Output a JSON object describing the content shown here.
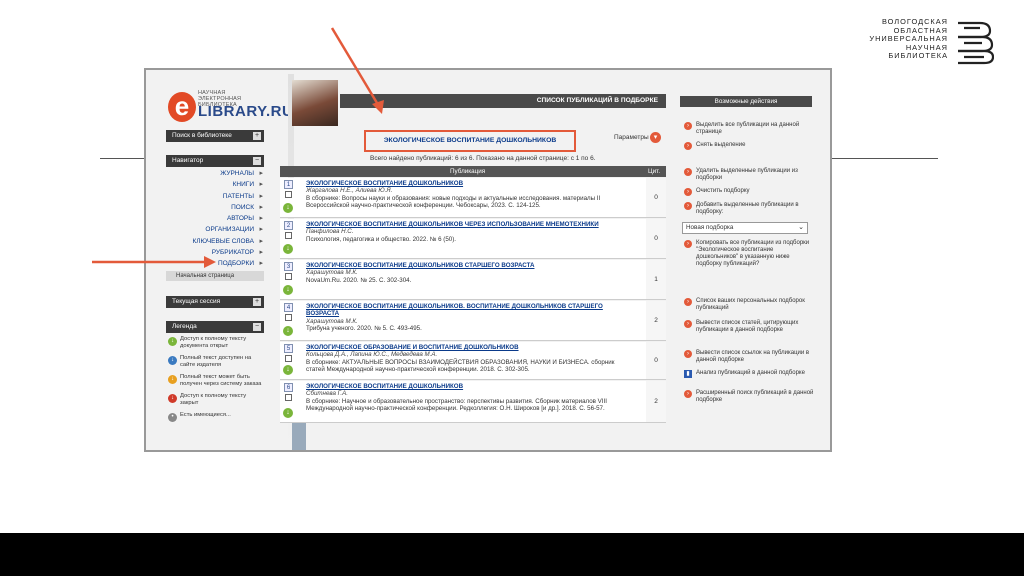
{
  "brand_logo": {
    "lines": [
      "ВОЛОГОДСКАЯ",
      "ОБЛАСТНАЯ",
      "УНИВЕРСАЛЬНАЯ",
      "НАУЧНАЯ",
      "БИБЛИОТЕКА"
    ]
  },
  "elib": {
    "logo_small": "НАУЧНАЯ ЭЛЕКТРОННАЯ БИБЛИОТЕКА",
    "logo_letter": "e",
    "logo_big": "LIBRARY.RU"
  },
  "left": {
    "search_library": "Поиск в библиотеке",
    "navigator": "Навигатор",
    "nav_items": [
      "ЖУРНАЛЫ",
      "КНИГИ",
      "ПАТЕНТЫ",
      "ПОИСК",
      "АВТОРЫ",
      "ОРГАНИЗАЦИИ",
      "КЛЮЧЕВЫЕ СЛОВА",
      "РУБРИКАТОР",
      "ПОДБОРКИ"
    ],
    "nav_sub": "Начальная страница",
    "current_session": "Текущая сессия",
    "legend_header": "Легенда",
    "legend_items": [
      "Доступ к полному тексту документа открыт",
      "Полный текст доступен на сайте издателя",
      "Полный текст может быть получен через систему заказа",
      "Доступ к полному тексту закрыт",
      "Есть имеющиеся..."
    ]
  },
  "center": {
    "header": "СПИСОК ПУБЛИКАЦИЙ В ПОДБОРКЕ",
    "selection_title": "ЭКОЛОГИЧЕСКОЕ ВОСПИТАНИЕ ДОШКОЛЬНИКОВ",
    "params_label": "Параметры",
    "found_text": "Всего найдено публикаций: 6 из 6.    Показано на данной странице: с 1 по 6.",
    "col_publication": "Публикация",
    "col_citations": "Цит.",
    "rows": [
      {
        "num": "1",
        "title": "ЭКОЛОГИЧЕСКОЕ ВОСПИТАНИЕ ДОШКОЛЬНИКОВ",
        "authors": "Жаргалова Н.Е., Алиева Ю.Я.",
        "source": "В сборнике: Вопросы науки и образования: новые подходы и актуальные исследования. материалы II Всероссийской научно-практической конференции. Чебоксары, 2023. С. 124-125.",
        "citations": "0"
      },
      {
        "num": "2",
        "title": "ЭКОЛОГИЧЕСКОЕ ВОСПИТАНИЕ ДОШКОЛЬНИКОВ ЧЕРЕЗ ИСПОЛЬЗОВАНИЕ МНЕМОТЕХНИКИ",
        "authors": "Панфилова Н.С.",
        "source": "Психология, педагогика и общество. 2022. № 6 (50).",
        "citations": "0"
      },
      {
        "num": "3",
        "title": "ЭКОЛОГИЧЕСКОЕ ВОСПИТАНИЕ ДОШКОЛЬНИКОВ СТАРШЕГО ВОЗРАСТА",
        "authors": "Харашутова М.К.",
        "source": "NovaUm.Ru. 2020. № 25. С. 302-304.",
        "citations": "1"
      },
      {
        "num": "4",
        "title": "ЭКОЛОГИЧЕСКОЕ ВОСПИТАНИЕ ДОШКОЛЬНИКОВ. ВОСПИТАНИЕ ДОШКОЛЬНИКОВ СТАРШЕГО ВОЗРАСТА",
        "authors": "Харашутова М.К.",
        "source": "Трибуна ученого. 2020. № 5. С. 493-495.",
        "citations": "2"
      },
      {
        "num": "5",
        "title": "ЭКОЛОГИЧЕСКОЕ ОБРАЗОВАНИЕ И ВОСПИТАНИЕ ДОШКОЛЬНИКОВ",
        "authors": "Кольцова Д.А., Лапина Ю.С., Медведева М.А.",
        "source": "В сборнике: АКТУАЛЬНЫЕ ВОПРОСЫ ВЗАИМОДЕЙСТВИЯ ОБРАЗОВАНИЯ, НАУКИ И БИЗНЕСА. сборник статей Международной научно-практической конференции. 2018. С. 302-305.",
        "citations": "0"
      },
      {
        "num": "6",
        "title": "ЭКОЛОГИЧЕСКОЕ ВОСПИТАНИЕ ДОШКОЛЬНИКОВ",
        "authors": "Сбитнева Г.А.",
        "source": "В сборнике: Научное и образовательное пространство: перспективы развития. Сборник материалов VIII Международной научно-практической конференции. Редколлегия: О.Н. Широков [и др.]. 2018. С. 56-57.",
        "citations": "2"
      }
    ]
  },
  "right": {
    "header": "Возможные действия",
    "actions_top": [
      "Выделить все публикации на данной странице",
      "Снять выделение"
    ],
    "actions_mid": [
      "Удалить выделенные публикации из подборки",
      "Очистить подборку",
      "Добавить выделенные публикации в подборку:"
    ],
    "select_value": "Новая подборка",
    "actions_bottom": [
      "Копировать все публикации из подборки \"Экологическое воспитание дошкольников\" в указанную ниже подборку публикаций?",
      "Список ваших персональных подборок публикаций",
      "Вывести список статей, цитирующих публикации в данной подборке",
      "Вывести список ссылок на публикации в данной подборке",
      "Анализ публикаций в данной подборке",
      "Расширенный поиск публикаций в данной подборке"
    ]
  },
  "colors": {
    "accent": "#e35a3a",
    "link": "#0a3a8a",
    "dark_bar": "#3a3a3a"
  }
}
